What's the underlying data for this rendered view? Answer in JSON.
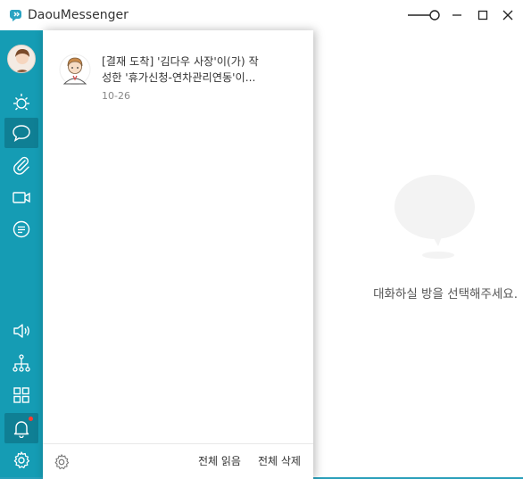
{
  "window": {
    "title": "DaouMessenger",
    "accent_color": "#159cb4",
    "controls": [
      "opacity-slider",
      "minimize",
      "maximize",
      "close"
    ]
  },
  "sidebar": {
    "items": [
      {
        "name": "avatar",
        "icon": "user-avatar",
        "active": false
      },
      {
        "name": "organization-chart",
        "icon": "sun-org-icon",
        "active": false
      },
      {
        "name": "chat",
        "icon": "speech-bubble-icon",
        "active": false
      },
      {
        "name": "files",
        "icon": "paperclip-icon",
        "active": false
      },
      {
        "name": "video",
        "icon": "video-camera-icon",
        "active": false
      },
      {
        "name": "messages",
        "icon": "message-icon",
        "active": false
      },
      {
        "name": "announcements",
        "icon": "speaker-icon",
        "active": false
      },
      {
        "name": "org-tree",
        "icon": "hierarchy-icon",
        "active": false
      },
      {
        "name": "apps",
        "icon": "grid-icon",
        "active": false
      },
      {
        "name": "notifications",
        "icon": "bell-icon",
        "active": true,
        "has_badge": true
      },
      {
        "name": "settings",
        "icon": "gear-icon",
        "active": false
      }
    ]
  },
  "notification": {
    "line1": "[결재 도착] '김다우 사장'이(가) 작",
    "line2": "성한 '휴가신청-연차관리연동'이...",
    "date": "10-26"
  },
  "footer": {
    "read_all": "전체 읽음",
    "delete_all": "전체 삭제"
  },
  "empty_state": {
    "text": "대화하실 방을 선택해주세요."
  }
}
